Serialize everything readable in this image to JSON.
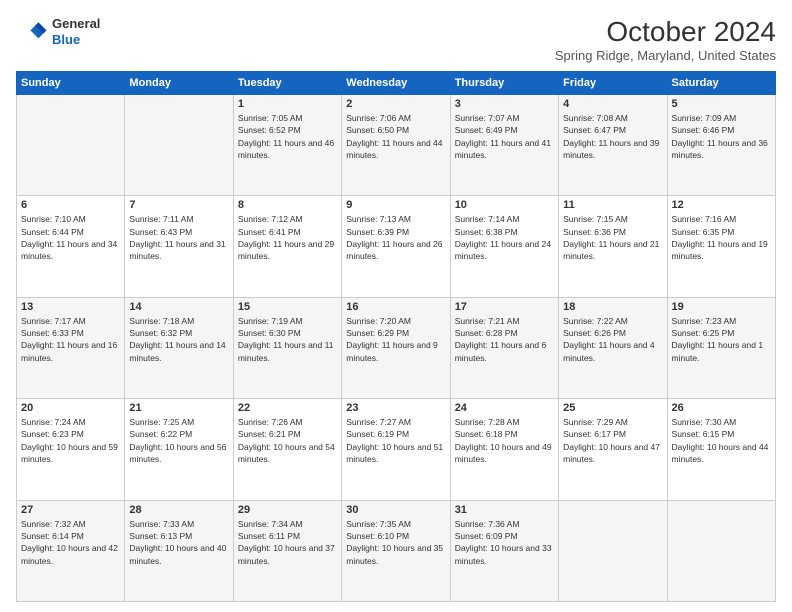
{
  "header": {
    "logo_line1": "General",
    "logo_line2": "Blue",
    "month": "October 2024",
    "location": "Spring Ridge, Maryland, United States"
  },
  "weekdays": [
    "Sunday",
    "Monday",
    "Tuesday",
    "Wednesday",
    "Thursday",
    "Friday",
    "Saturday"
  ],
  "weeks": [
    [
      {
        "day": "",
        "info": ""
      },
      {
        "day": "",
        "info": ""
      },
      {
        "day": "1",
        "info": "Sunrise: 7:05 AM\nSunset: 6:52 PM\nDaylight: 11 hours and 46 minutes."
      },
      {
        "day": "2",
        "info": "Sunrise: 7:06 AM\nSunset: 6:50 PM\nDaylight: 11 hours and 44 minutes."
      },
      {
        "day": "3",
        "info": "Sunrise: 7:07 AM\nSunset: 6:49 PM\nDaylight: 11 hours and 41 minutes."
      },
      {
        "day": "4",
        "info": "Sunrise: 7:08 AM\nSunset: 6:47 PM\nDaylight: 11 hours and 39 minutes."
      },
      {
        "day": "5",
        "info": "Sunrise: 7:09 AM\nSunset: 6:46 PM\nDaylight: 11 hours and 36 minutes."
      }
    ],
    [
      {
        "day": "6",
        "info": "Sunrise: 7:10 AM\nSunset: 6:44 PM\nDaylight: 11 hours and 34 minutes."
      },
      {
        "day": "7",
        "info": "Sunrise: 7:11 AM\nSunset: 6:43 PM\nDaylight: 11 hours and 31 minutes."
      },
      {
        "day": "8",
        "info": "Sunrise: 7:12 AM\nSunset: 6:41 PM\nDaylight: 11 hours and 29 minutes."
      },
      {
        "day": "9",
        "info": "Sunrise: 7:13 AM\nSunset: 6:39 PM\nDaylight: 11 hours and 26 minutes."
      },
      {
        "day": "10",
        "info": "Sunrise: 7:14 AM\nSunset: 6:38 PM\nDaylight: 11 hours and 24 minutes."
      },
      {
        "day": "11",
        "info": "Sunrise: 7:15 AM\nSunset: 6:36 PM\nDaylight: 11 hours and 21 minutes."
      },
      {
        "day": "12",
        "info": "Sunrise: 7:16 AM\nSunset: 6:35 PM\nDaylight: 11 hours and 19 minutes."
      }
    ],
    [
      {
        "day": "13",
        "info": "Sunrise: 7:17 AM\nSunset: 6:33 PM\nDaylight: 11 hours and 16 minutes."
      },
      {
        "day": "14",
        "info": "Sunrise: 7:18 AM\nSunset: 6:32 PM\nDaylight: 11 hours and 14 minutes."
      },
      {
        "day": "15",
        "info": "Sunrise: 7:19 AM\nSunset: 6:30 PM\nDaylight: 11 hours and 11 minutes."
      },
      {
        "day": "16",
        "info": "Sunrise: 7:20 AM\nSunset: 6:29 PM\nDaylight: 11 hours and 9 minutes."
      },
      {
        "day": "17",
        "info": "Sunrise: 7:21 AM\nSunset: 6:28 PM\nDaylight: 11 hours and 6 minutes."
      },
      {
        "day": "18",
        "info": "Sunrise: 7:22 AM\nSunset: 6:26 PM\nDaylight: 11 hours and 4 minutes."
      },
      {
        "day": "19",
        "info": "Sunrise: 7:23 AM\nSunset: 6:25 PM\nDaylight: 11 hours and 1 minute."
      }
    ],
    [
      {
        "day": "20",
        "info": "Sunrise: 7:24 AM\nSunset: 6:23 PM\nDaylight: 10 hours and 59 minutes."
      },
      {
        "day": "21",
        "info": "Sunrise: 7:25 AM\nSunset: 6:22 PM\nDaylight: 10 hours and 56 minutes."
      },
      {
        "day": "22",
        "info": "Sunrise: 7:26 AM\nSunset: 6:21 PM\nDaylight: 10 hours and 54 minutes."
      },
      {
        "day": "23",
        "info": "Sunrise: 7:27 AM\nSunset: 6:19 PM\nDaylight: 10 hours and 51 minutes."
      },
      {
        "day": "24",
        "info": "Sunrise: 7:28 AM\nSunset: 6:18 PM\nDaylight: 10 hours and 49 minutes."
      },
      {
        "day": "25",
        "info": "Sunrise: 7:29 AM\nSunset: 6:17 PM\nDaylight: 10 hours and 47 minutes."
      },
      {
        "day": "26",
        "info": "Sunrise: 7:30 AM\nSunset: 6:15 PM\nDaylight: 10 hours and 44 minutes."
      }
    ],
    [
      {
        "day": "27",
        "info": "Sunrise: 7:32 AM\nSunset: 6:14 PM\nDaylight: 10 hours and 42 minutes."
      },
      {
        "day": "28",
        "info": "Sunrise: 7:33 AM\nSunset: 6:13 PM\nDaylight: 10 hours and 40 minutes."
      },
      {
        "day": "29",
        "info": "Sunrise: 7:34 AM\nSunset: 6:11 PM\nDaylight: 10 hours and 37 minutes."
      },
      {
        "day": "30",
        "info": "Sunrise: 7:35 AM\nSunset: 6:10 PM\nDaylight: 10 hours and 35 minutes."
      },
      {
        "day": "31",
        "info": "Sunrise: 7:36 AM\nSunset: 6:09 PM\nDaylight: 10 hours and 33 minutes."
      },
      {
        "day": "",
        "info": ""
      },
      {
        "day": "",
        "info": ""
      }
    ]
  ]
}
